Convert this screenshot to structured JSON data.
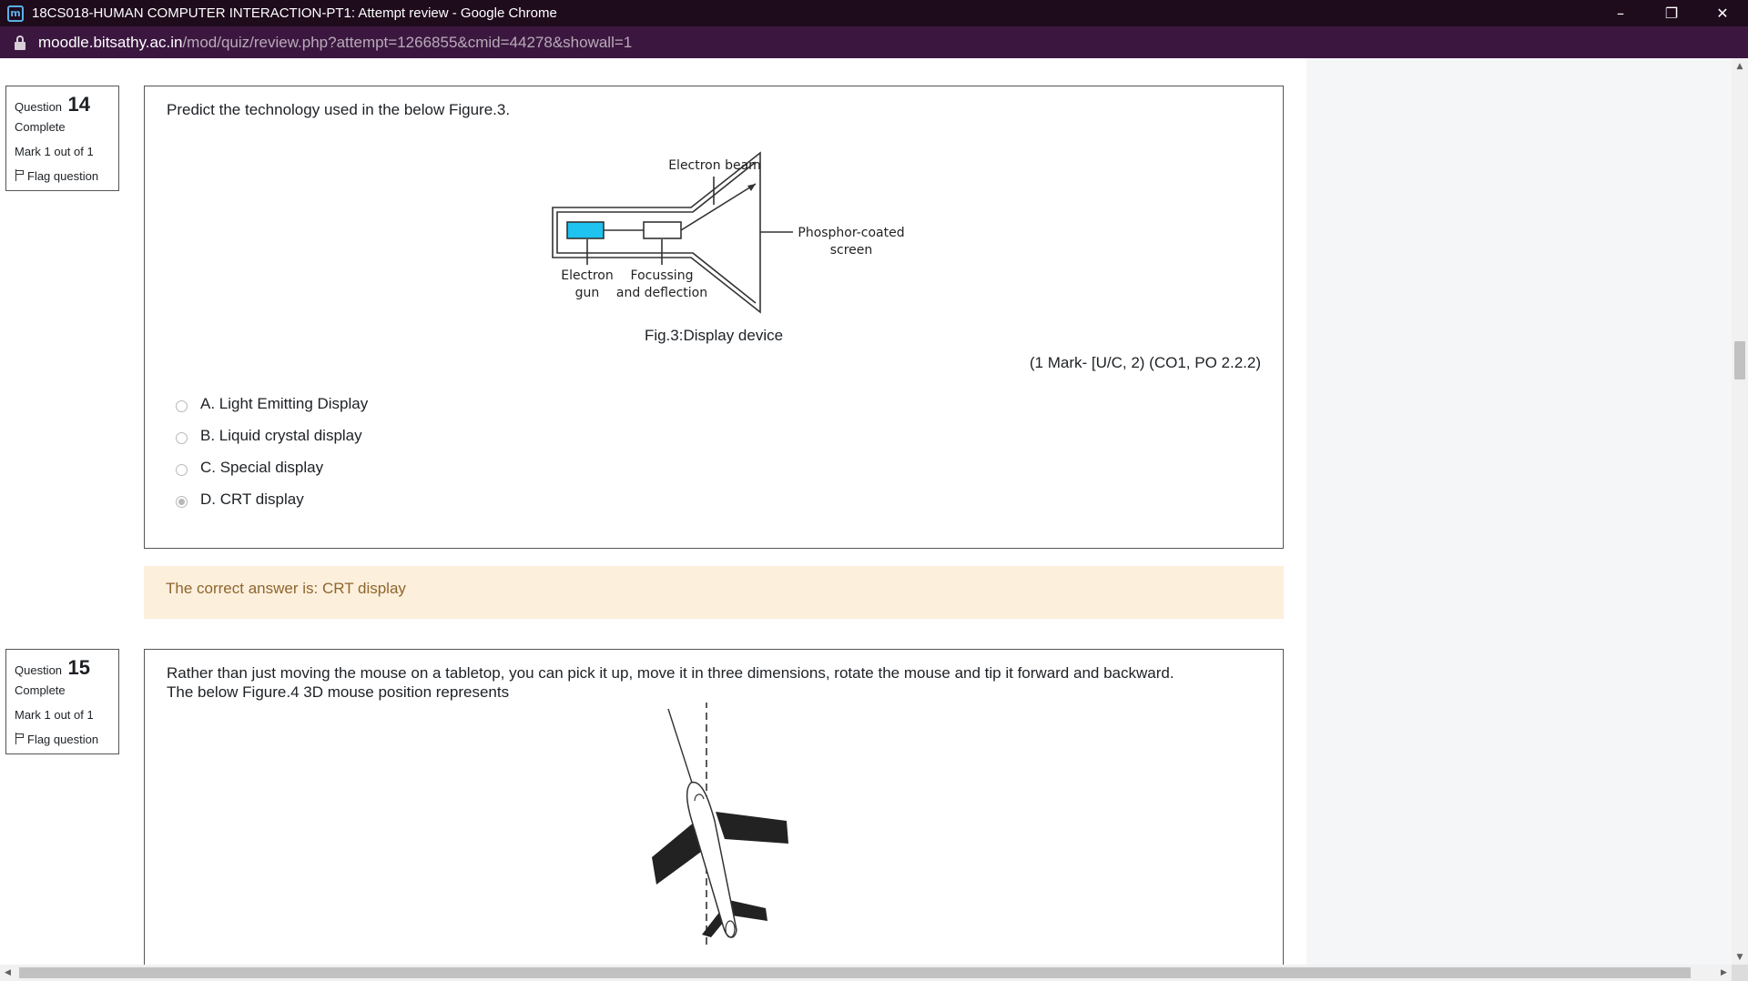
{
  "window": {
    "title": "18CS018-HUMAN COMPUTER INTERACTION-PT1: Attempt review - Google Chrome",
    "controls": {
      "minimize": "–",
      "restore": "❐",
      "close": "✕"
    }
  },
  "address_bar": {
    "domain": "moodle.bitsathy.ac.in",
    "path": "/mod/quiz/review.php?attempt=1266855&cmid=44278&showall=1"
  },
  "questions": [
    {
      "label": "Question",
      "number": "14",
      "state": "Complete",
      "grade": "Mark 1 out of 1",
      "flag": "Flag question",
      "text": "Predict the technology used in the below Figure.3.",
      "figure": {
        "labels": {
          "beam": "Electron beam",
          "screen_1": "Phosphor-coated",
          "screen_2": "screen",
          "gun_1": "Electron",
          "gun_2": "gun",
          "focus_1": "Focussing",
          "focus_2": "and deflection"
        }
      },
      "caption": "Fig.3:Display device",
      "marks": "(1 Mark- [U/C, 2) (CO1, PO 2.2.2)",
      "answers": [
        {
          "label": "A. Light Emitting Display",
          "checked": false
        },
        {
          "label": "B. Liquid crystal display",
          "checked": false
        },
        {
          "label": "C. Special display",
          "checked": false
        },
        {
          "label": "D. CRT display",
          "checked": true
        }
      ],
      "feedback": "The correct answer is: CRT display"
    },
    {
      "label": "Question",
      "number": "15",
      "state": "Complete",
      "grade": "Mark 1 out of 1",
      "flag": "Flag question",
      "text_line1": "Rather than just moving the mouse on a tabletop, you can pick it up, move it in three dimensions, rotate the mouse and tip it forward and backward.",
      "text_line2": "The below Figure.4 3D mouse position represents"
    }
  ],
  "colors": {
    "title_bar": "#1e0b1c",
    "address_bar": "#3b1740",
    "feedback_bg": "#fcefdc",
    "feedback_text": "#8e662e",
    "electron_gun_fill": "#1ec3f0"
  }
}
